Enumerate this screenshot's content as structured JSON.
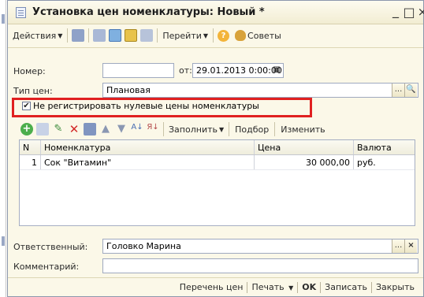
{
  "window": {
    "title": "Установка цен номенклатуры: Новый *"
  },
  "toolbar": {
    "actions_label": "Действия",
    "goto_label": "Перейти",
    "advice_label": "Советы"
  },
  "form": {
    "number_label": "Номер:",
    "number_value": "",
    "date_label": "от:",
    "date_value": "29.01.2013  0:00:00",
    "price_type_label": "Тип цен:",
    "price_type_value": "Плановая",
    "checkbox_label": "Не регистрировать нулевые цены номенклатуры",
    "checkbox_checked": true
  },
  "table_toolbar": {
    "fill_label": "Заполнить",
    "pick_label": "Подбор",
    "change_label": "Изменить"
  },
  "table": {
    "columns": [
      "N",
      "Номенклатура",
      "Цена",
      "Валюта"
    ],
    "rows": [
      {
        "n": "1",
        "item": "Сок \"Витамин\"",
        "price": "30 000,00",
        "currency": "руб."
      }
    ]
  },
  "footer": {
    "responsible_label": "Ответственный:",
    "responsible_value": "Головко Марина",
    "comment_label": "Комментарий:",
    "comment_value": ""
  },
  "bottom_bar": {
    "price_list": "Перечень цен",
    "print": "Печать",
    "ok": "OK",
    "save": "Записать",
    "close": "Закрыть"
  },
  "colors": {
    "highlight": "#e02020",
    "window_bg": "#fbf8e8"
  }
}
